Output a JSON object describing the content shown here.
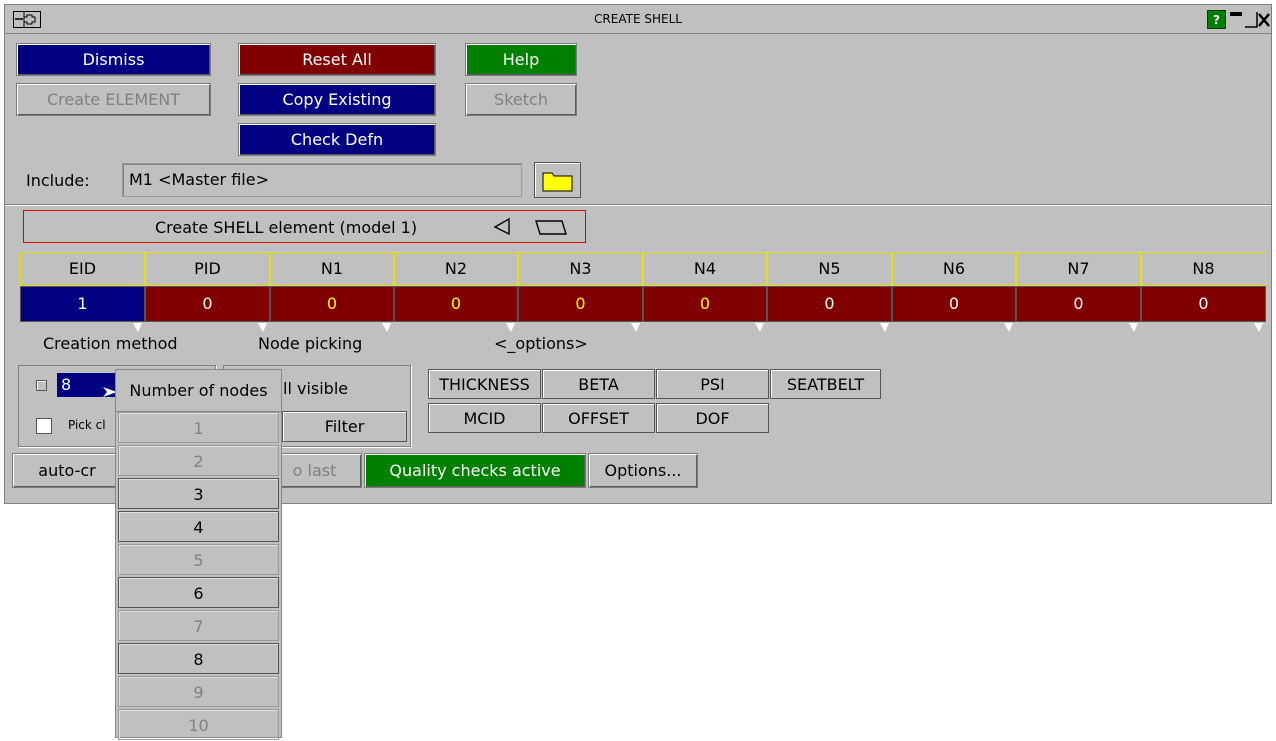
{
  "window": {
    "title": "CREATE SHELL",
    "system_menu_glyph": "—⌑",
    "help_icon_label": "?"
  },
  "buttons": {
    "dismiss": "Dismiss",
    "reset_all": "Reset All",
    "help": "Help",
    "create_element": "Create ELEMENT",
    "copy_existing": "Copy Existing",
    "sketch": "Sketch",
    "check_defn": "Check Defn"
  },
  "include": {
    "label": "Include:",
    "value": "M1  <Master file>"
  },
  "create_banner": "Create SHELL element (model 1)",
  "table": {
    "headers": [
      "EID",
      "PID",
      "N1",
      "N2",
      "N3",
      "N4",
      "N5",
      "N6",
      "N7",
      "N8"
    ],
    "values": [
      "1",
      "0",
      "0",
      "0",
      "0",
      "0",
      "0",
      "0",
      "0",
      "0"
    ]
  },
  "sections": {
    "creation_method": "Creation method",
    "node_picking": "Node picking",
    "options": "<_options>"
  },
  "creation": {
    "nodes_value": "8",
    "pick_label": "Pick cl"
  },
  "node_picking": {
    "visible_label": "ll visible",
    "filter": "Filter"
  },
  "option_buttons": {
    "thickness": "THICKNESS",
    "beta": "BETA",
    "psi": "PSI",
    "seatbelt": "SEATBELT",
    "mcid": "MCID",
    "offset": "OFFSET",
    "dof": "DOF"
  },
  "bottom": {
    "auto": "auto-cr",
    "to_last": "o last",
    "quality": "Quality checks active",
    "options": "Options..."
  },
  "dropdown": {
    "header": "Number of nodes",
    "items": [
      "1",
      "2",
      "3",
      "4",
      "5",
      "6",
      "7",
      "8",
      "9",
      "10"
    ],
    "enabled": [
      false,
      false,
      true,
      true,
      false,
      true,
      false,
      true,
      false,
      false
    ]
  },
  "colors": {
    "panel": "#c0c0c0",
    "blue": "#000080",
    "red": "#800000",
    "green": "#008000",
    "header_border": "#e8e000",
    "node_value_text": "#ffff00"
  }
}
